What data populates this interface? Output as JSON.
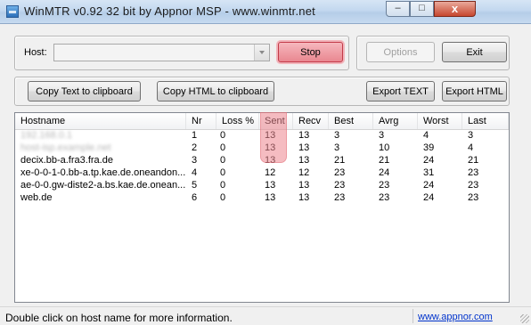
{
  "window": {
    "title": "WinMTR v0.92 32 bit by Appnor MSP - www.winmtr.net",
    "min_label": "–",
    "max_label": "□",
    "close_label": "x"
  },
  "controls": {
    "host_label": "Host:",
    "host_value": "",
    "stop_label": "Stop",
    "options_label": "Options",
    "exit_label": "Exit",
    "copy_text_label": "Copy Text to clipboard",
    "copy_html_label": "Copy HTML to clipboard",
    "export_text_label": "Export TEXT",
    "export_html_label": "Export HTML"
  },
  "table": {
    "columns": [
      "Hostname",
      "Nr",
      "Loss %",
      "Sent",
      "Recv",
      "Best",
      "Avrg",
      "Worst",
      "Last"
    ],
    "rows": [
      [
        "192.168.0.1",
        "1",
        "0",
        "13",
        "13",
        "3",
        "3",
        "4",
        "3"
      ],
      [
        "host-isp.example.net",
        "2",
        "0",
        "13",
        "13",
        "3",
        "10",
        "39",
        "4"
      ],
      [
        "decix.bb-a.fra3.fra.de",
        "3",
        "0",
        "13",
        "13",
        "21",
        "21",
        "24",
        "21"
      ],
      [
        "xe-0-0-1-0.bb-a.tp.kae.de.oneandon...",
        "4",
        "0",
        "12",
        "12",
        "23",
        "24",
        "31",
        "23"
      ],
      [
        "ae-0-0.gw-diste2-a.bs.kae.de.onean...",
        "5",
        "0",
        "13",
        "13",
        "23",
        "23",
        "24",
        "23"
      ],
      [
        "web.de",
        "6",
        "0",
        "13",
        "13",
        "23",
        "23",
        "24",
        "23"
      ]
    ]
  },
  "status": {
    "text": "Double click on host name for more information.",
    "link": "www.appnor.com"
  },
  "colors": {
    "stop_highlight": "#e98790",
    "sent_highlight": "#ed858e",
    "link": "#0033cc"
  }
}
